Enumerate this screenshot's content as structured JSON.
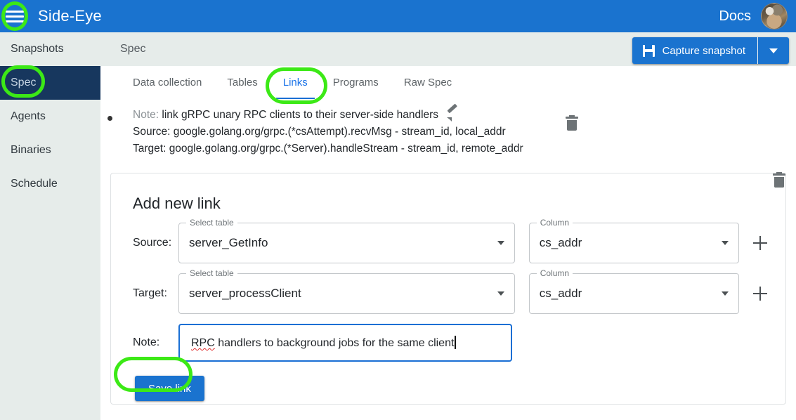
{
  "appbar": {
    "menu_icon": "hamburger-menu-icon",
    "title": "Side-Eye",
    "docs_label": "Docs",
    "avatar_alt": "user-avatar"
  },
  "sidebar": {
    "items": [
      {
        "label": "Snapshots",
        "active": false
      },
      {
        "label": "Spec",
        "active": true
      },
      {
        "label": "Agents",
        "active": false
      },
      {
        "label": "Binaries",
        "active": false
      },
      {
        "label": "Schedule",
        "active": false
      }
    ]
  },
  "breadcrumb": {
    "label": "Spec"
  },
  "capture": {
    "label": "Capture snapshot",
    "icon": "save-disk-icon",
    "dropdown_icon": "chevron-down-icon"
  },
  "tabs": [
    {
      "label": "Data collection",
      "active": false
    },
    {
      "label": "Tables",
      "active": false
    },
    {
      "label": "Links",
      "active": true
    },
    {
      "label": "Programs",
      "active": false
    },
    {
      "label": "Raw Spec",
      "active": false
    }
  ],
  "existing_links": [
    {
      "note_label": "Note:",
      "note_value": "link gRPC unary RPC clients to their server-side handlers",
      "source_line": "Source: google.golang.org/grpc.(*csAttempt).recvMsg - stream_id, local_addr",
      "target_line": "Target: google.golang.org/grpc.(*Server).handleStream - stream_id, remote_addr",
      "edit_icon": "pencil-edit-icon",
      "delete_icon": "trash-delete-icon"
    }
  ],
  "add_link_form": {
    "title": "Add new link",
    "source": {
      "row_label": "Source:",
      "table_legend": "Select table",
      "table_value": "server_GetInfo",
      "column_legend": "Column",
      "column_value": "cs_addr",
      "delete_icon": "trash-delete-icon",
      "add_icon": "plus-add-icon"
    },
    "target": {
      "row_label": "Target:",
      "table_legend": "Select table",
      "table_value": "server_processClient",
      "column_legend": "Column",
      "column_value": "cs_addr",
      "delete_icon": "trash-delete-icon",
      "add_icon": "plus-add-icon"
    },
    "note": {
      "row_label": "Note:",
      "value_misspelled": "RPC",
      "value_rest": " handlers to background jobs for the same client",
      "placeholder": ""
    },
    "save_label": "Save link"
  },
  "colors": {
    "appbar_blue": "#1a73cf",
    "sidebar_bg": "#e6ecea",
    "sidebar_active_bg": "#17375e",
    "tab_active_blue": "#1a73e8",
    "annotation_green": "#3ce916",
    "focus_border_blue": "#1a6fd4",
    "spellcheck_red": "#e03030"
  },
  "annotations": [
    {
      "name": "hamburger-menu-highlight"
    },
    {
      "name": "sidebar-spec-highlight"
    },
    {
      "name": "links-tab-highlight"
    },
    {
      "name": "save-link-highlight"
    }
  ]
}
